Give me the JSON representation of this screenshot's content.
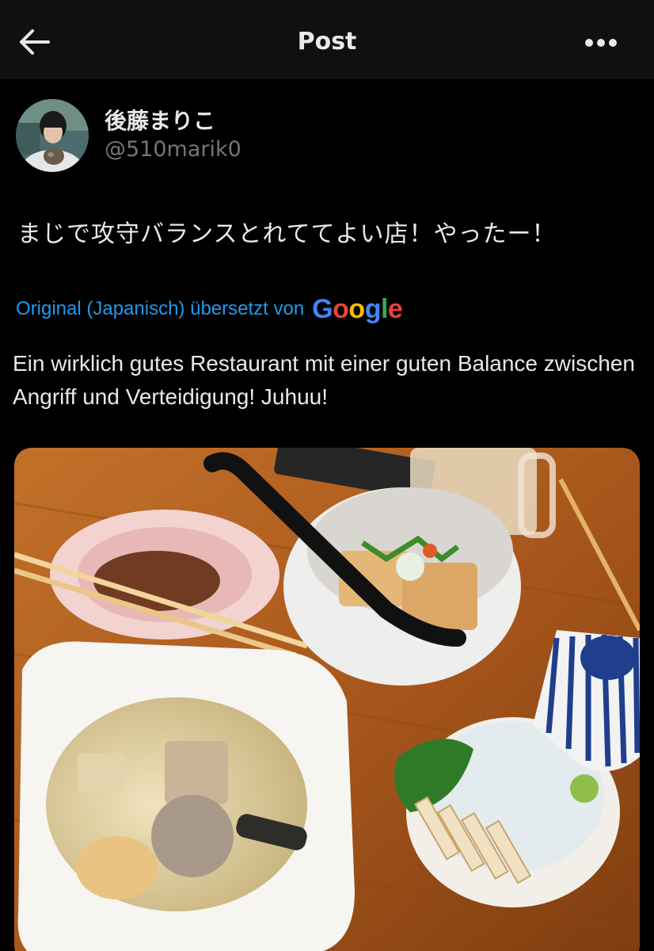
{
  "header": {
    "title": "Post",
    "back_icon": "arrow-left-icon",
    "more_icon": "more-horizontal-icon"
  },
  "author": {
    "display_name": "後藤まりこ",
    "handle": "@510marik0"
  },
  "post": {
    "text": "まじで攻守バランスとれててよい店！やったー！",
    "translation_label": "Original (Japanisch) übersetzt von",
    "translation_provider": "Google",
    "translated_text": "Ein wirklich gutes Restaurant mit einer guten Balance zwischen Angriff und Verteidigung! Juhuu!"
  },
  "colors": {
    "background": "#000000",
    "header_bg": "#101010",
    "text_primary": "#e7e9ea",
    "text_secondary": "#71767b",
    "link_blue": "#1d9bf0",
    "google_blue": "#4285F4",
    "google_red": "#EA4335",
    "google_yellow": "#FBBC05",
    "google_green": "#34A853"
  }
}
